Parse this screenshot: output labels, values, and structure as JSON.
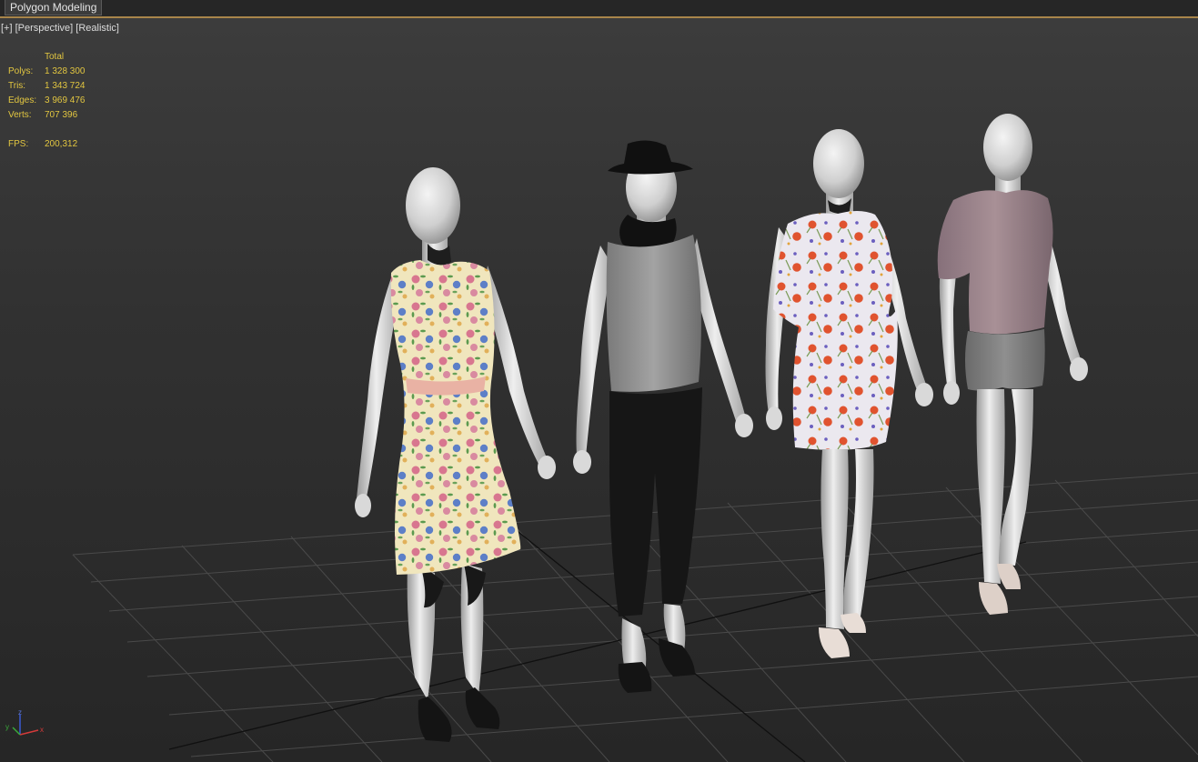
{
  "ribbon": {
    "tab_label": "Polygon Modeling"
  },
  "viewport": {
    "labels": {
      "plus": "[+]",
      "view": "[Perspective]",
      "shading": "[Realistic]"
    },
    "stats": {
      "header": "Total",
      "polys_label": "Polys:",
      "polys": "1 328 300",
      "tris_label": "Tris:",
      "tris": "1 343 724",
      "edges_label": "Edges:",
      "edges": "3 969 476",
      "verts_label": "Verts:",
      "verts": "707 396",
      "fps_label": "FPS:",
      "fps": "200,312"
    },
    "axes": {
      "z": "z",
      "y": "y",
      "x": "x"
    }
  },
  "colors": {
    "ribbon_accent": "#a8854a",
    "stats_text": "#e2c640",
    "grid": "#4a4a4a",
    "axis_x": "#d43a3a",
    "axis_y": "#3aaa3a",
    "axis_z": "#3a5ad4"
  }
}
